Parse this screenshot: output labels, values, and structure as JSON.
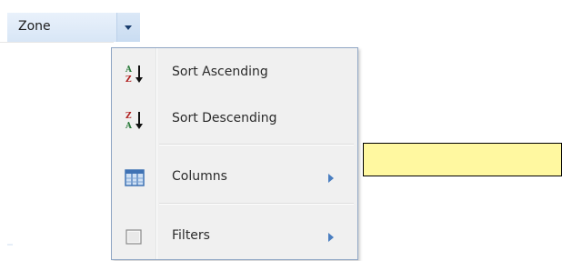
{
  "header": {
    "column_label": "Zone",
    "trigger_icon": "chevron-down-icon"
  },
  "menu": {
    "items": [
      {
        "label": "Sort Ascending",
        "icon": "sort-ascending-icon",
        "has_submenu": false
      },
      {
        "label": "Sort Descending",
        "icon": "sort-descending-icon",
        "has_submenu": false
      },
      {
        "label": "Columns",
        "icon": "columns-icon",
        "has_submenu": true
      },
      {
        "label": "Filters",
        "icon": "filter-checkbox-icon",
        "has_submenu": true,
        "checked": false
      }
    ]
  },
  "callout": {
    "color": "#fff8a0"
  },
  "colors": {
    "header_bg": "#dbe8f7",
    "menu_bg": "#f0f0f0",
    "menu_border": "#8fa6c4",
    "accent_arrow": "#4a7ec0"
  }
}
